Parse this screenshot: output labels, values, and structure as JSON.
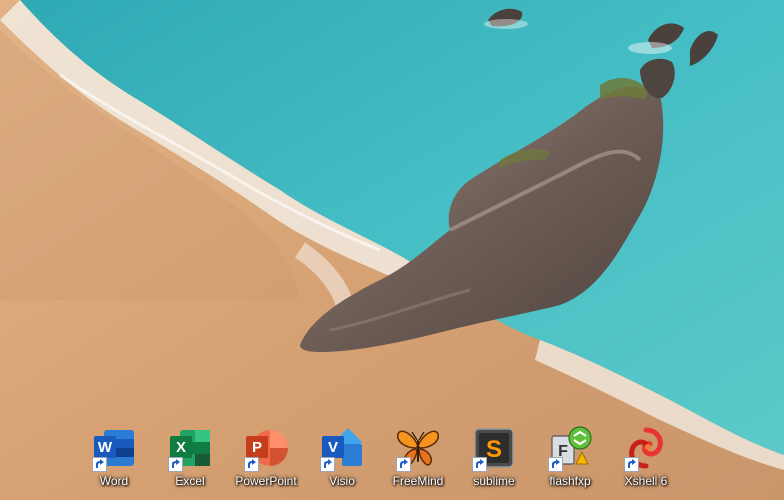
{
  "desktop": {
    "icons": [
      {
        "label": "Word",
        "icon": "word-icon"
      },
      {
        "label": "Excel",
        "icon": "excel-icon"
      },
      {
        "label": "PowerPoint",
        "icon": "powerpoint-icon"
      },
      {
        "label": "Visio",
        "icon": "visio-icon"
      },
      {
        "label": "FreeMind",
        "icon": "freemind-icon"
      },
      {
        "label": "sublime",
        "icon": "sublime-icon"
      },
      {
        "label": "flashfxp",
        "icon": "flashfxp-icon"
      },
      {
        "label": "Xshell 6",
        "icon": "xshell-icon"
      }
    ]
  },
  "colors": {
    "sea": "#3fb8c0",
    "sand": "#d9a878",
    "foam": "#f2ece4",
    "rock": "#6e6058"
  }
}
